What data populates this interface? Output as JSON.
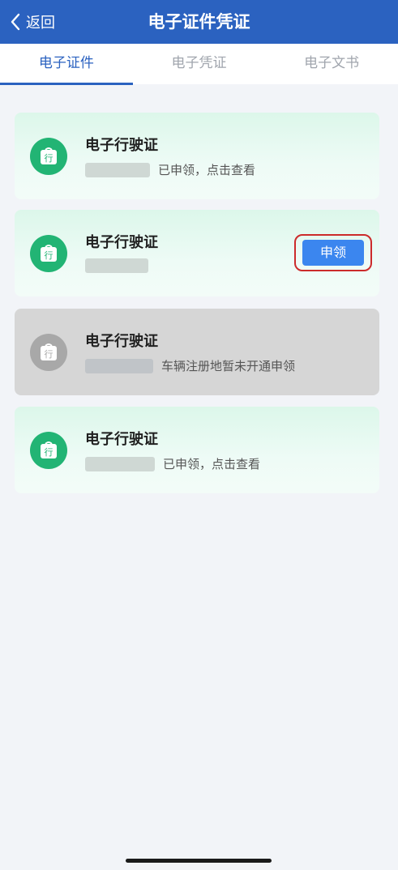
{
  "header": {
    "back_label": "返回",
    "title": "电子证件凭证"
  },
  "tabs": [
    {
      "label": "电子证件",
      "active": true
    },
    {
      "label": "电子凭证",
      "active": false
    },
    {
      "label": "电子文书",
      "active": false
    }
  ],
  "cards": [
    {
      "icon_char": "行",
      "title": "电子行驶证",
      "status": "已申领，点击查看"
    },
    {
      "icon_char": "行",
      "title": "电子行驶证",
      "status": "",
      "button_label": "申领"
    },
    {
      "icon_char": "行",
      "title": "电子行驶证",
      "status": "车辆注册地暂未开通申领"
    },
    {
      "icon_char": "行",
      "title": "电子行驶证",
      "status": "已申领，点击查看"
    }
  ],
  "colors": {
    "header": "#2b62c0",
    "icon_green": "#22b474",
    "icon_gray": "#a8a8a8",
    "button_blue": "#3b86ef",
    "highlight_red": "#cc2b2b"
  },
  "icons": {
    "back": "chevron-left-icon",
    "license": "license-bag-icon"
  }
}
